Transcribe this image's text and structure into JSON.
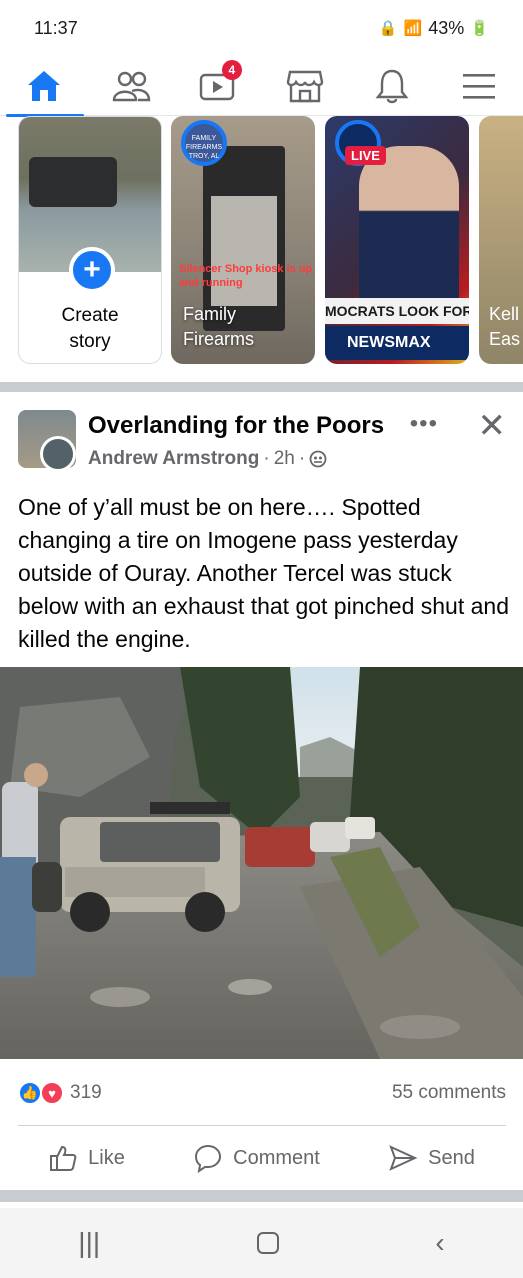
{
  "status_bar": {
    "time": "11:37",
    "battery": "43%"
  },
  "nav": {
    "items": [
      {
        "name": "home",
        "icon": "home-icon",
        "active": true
      },
      {
        "name": "friends",
        "icon": "friends-icon"
      },
      {
        "name": "video",
        "icon": "video-icon",
        "badge": "4"
      },
      {
        "name": "marketplace",
        "icon": "marketplace-icon"
      },
      {
        "name": "notifications",
        "icon": "bell-icon"
      },
      {
        "name": "menu",
        "icon": "hamburger-icon"
      }
    ],
    "video_badge": "4"
  },
  "stories": {
    "create_label_line1": "Create",
    "create_label_line2": "story",
    "family": {
      "title_line1": "Family",
      "title_line2": "Firearms",
      "kiosk_caption": "Silencer Shop kiosk is up and running",
      "logo_text": "FAMILY FIREARMS TROY, AL"
    },
    "newsmax": {
      "live": "LIVE",
      "ticker": "MOCRATS LOOK FOR A",
      "logo": "NEWSMAX"
    },
    "kelly": {
      "title_line1": "Kell",
      "title_line2": "Eas"
    }
  },
  "post": {
    "group": "Overlanding for the Poors",
    "author": "Andrew Armstrong",
    "time": "2h",
    "text": "One of y’all must be on here…. Spotted changing a tire on Imogene pass yesterday outside of Ouray.  Another Tercel was stuck below with an exhaust that got pinched shut and killed the engine.",
    "reactions_count": "319",
    "comments": "55 comments",
    "actions": {
      "like": "Like",
      "comment": "Comment",
      "send": "Send"
    }
  },
  "colors": {
    "brand_blue": "#1877f2",
    "badge_red": "#e41e3f",
    "secondary_text": "#65676b",
    "divider": "#c9ccd1"
  }
}
